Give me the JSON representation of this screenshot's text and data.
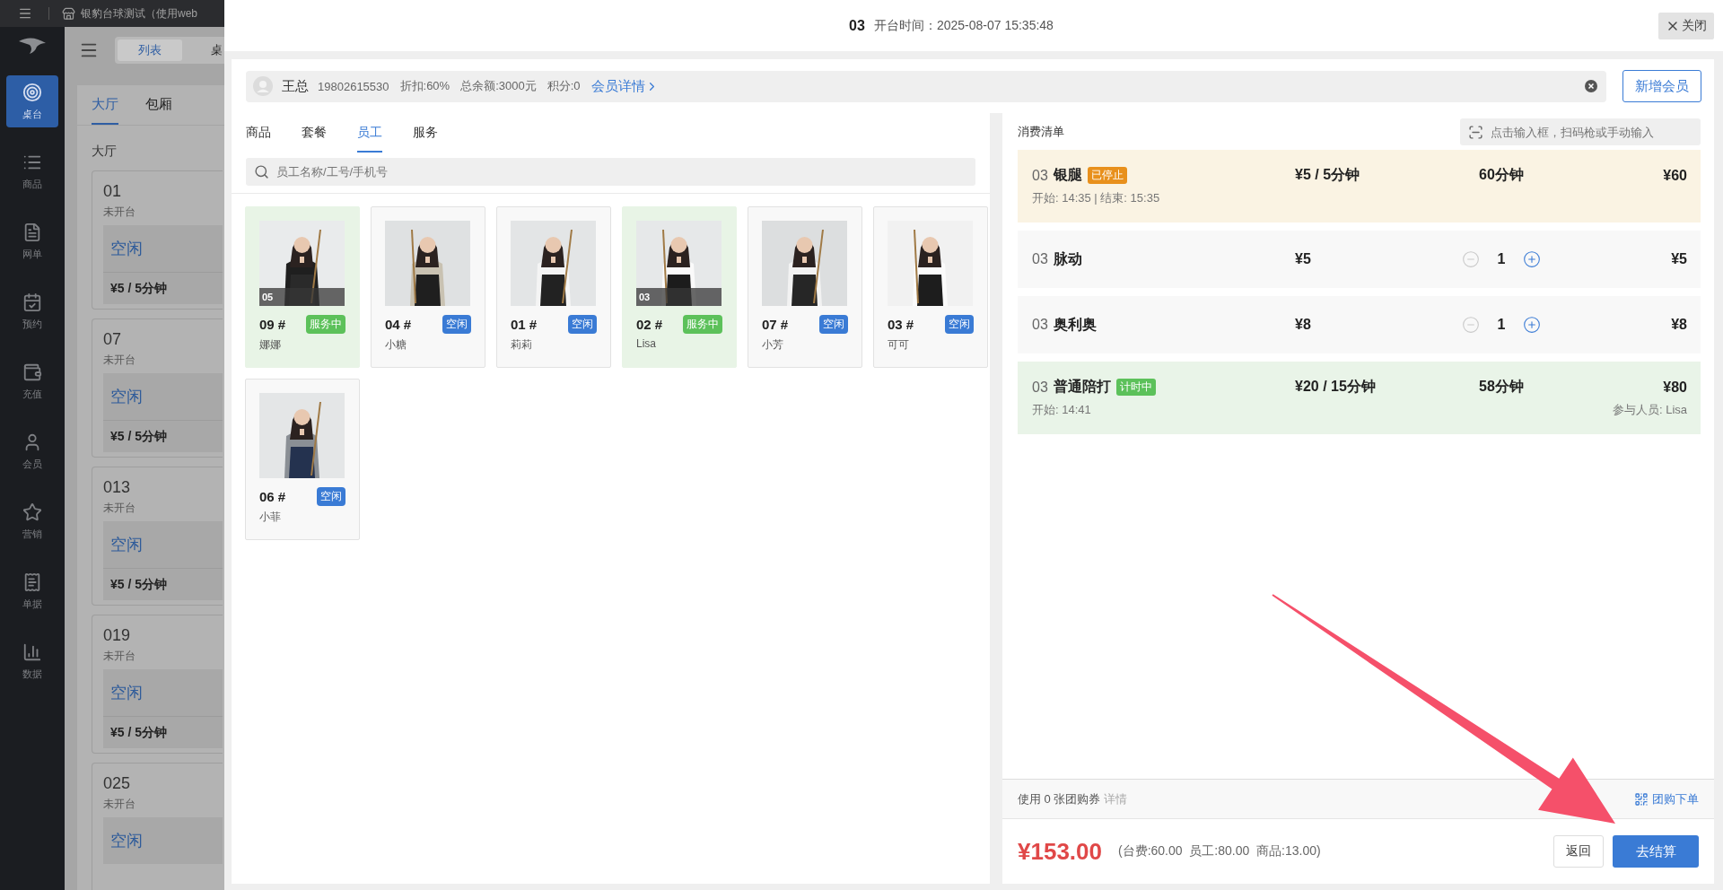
{
  "top_bar": {
    "title": "银豹台球测试（使用web"
  },
  "sidebar": {
    "items": [
      {
        "label": "桌台",
        "selected": true
      },
      {
        "label": "商品",
        "selected": false
      },
      {
        "label": "网单",
        "selected": false
      },
      {
        "label": "预约",
        "selected": false
      },
      {
        "label": "充值",
        "selected": false
      },
      {
        "label": "会员",
        "selected": false
      },
      {
        "label": "营销",
        "selected": false
      },
      {
        "label": "单据",
        "selected": false
      },
      {
        "label": "数据",
        "selected": false
      }
    ]
  },
  "toolbar": {
    "views": [
      {
        "label": "列表",
        "selected": true
      },
      {
        "label": "桌",
        "selected": false
      }
    ]
  },
  "areas": {
    "tabs": [
      {
        "label": "大厅",
        "selected": true
      },
      {
        "label": "包厢",
        "selected": false
      }
    ],
    "section": "大厅",
    "tables": [
      {
        "number": "01",
        "state": "未开台",
        "status": "空闲",
        "price": "¥5 / 5分钟"
      },
      {
        "number": "07",
        "state": "未开台",
        "status": "空闲",
        "price": "¥5 / 5分钟"
      },
      {
        "number": "013",
        "state": "未开台",
        "status": "空闲",
        "price": "¥5 / 5分钟"
      },
      {
        "number": "019",
        "state": "未开台",
        "status": "空闲",
        "price": "¥5 / 5分钟"
      },
      {
        "number": "025",
        "state": "未开台",
        "status": "空闲"
      }
    ]
  },
  "modal": {
    "table": "03",
    "open_time": "开台时间：2025-08-07 15:35:48",
    "close_button": "关闭",
    "member": {
      "name": "王总",
      "phone": "19802615530",
      "discount": "折扣:60%",
      "balance": "总余额:3000元",
      "points": "积分:0",
      "detail_link": "会员详情"
    },
    "add_member_button": "新增会员",
    "tabs": [
      {
        "label": "商品",
        "selected": false
      },
      {
        "label": "套餐",
        "selected": false
      },
      {
        "label": "员工",
        "selected": true
      },
      {
        "label": "服务",
        "selected": false
      }
    ],
    "search": {
      "placeholder": "员工名称/工号/手机号"
    },
    "staff": [
      {
        "number": "09 #",
        "name": "娜娜",
        "status": "服务中",
        "kind": "serving",
        "table_badge": "05"
      },
      {
        "number": "04 #",
        "name": "小糖",
        "status": "空闲",
        "kind": "idle"
      },
      {
        "number": "01 #",
        "name": "莉莉",
        "status": "空闲",
        "kind": "idle"
      },
      {
        "number": "02 #",
        "name": "Lisa",
        "status": "服务中",
        "kind": "serving",
        "table_badge": "03"
      },
      {
        "number": "07 #",
        "name": "小芳",
        "status": "空闲",
        "kind": "idle"
      },
      {
        "number": "03 #",
        "name": "可可",
        "status": "空闲",
        "kind": "idle"
      },
      {
        "number": "06 #",
        "name": "小菲",
        "status": "空闲",
        "kind": "idle"
      }
    ],
    "order": {
      "title": "消费清单",
      "scan": {
        "placeholder": "点击输入框，扫码枪或手动输入"
      },
      "items": [
        {
          "kind": "timed",
          "table": "03",
          "name": "银腿",
          "badge": {
            "text": "已停止",
            "kind": "stopped"
          },
          "price": "¥5 / 5分钟",
          "duration": "60分钟",
          "amount": "¥60",
          "times": "开始: 14:35 | 结束: 15:35"
        },
        {
          "kind": "product",
          "table": "03",
          "name": "脉动",
          "price": "¥5",
          "qty": "1",
          "minus_disabled": true,
          "amount": "¥5"
        },
        {
          "kind": "product",
          "table": "03",
          "name": "奥利奥",
          "price": "¥8",
          "qty": "1",
          "minus_disabled": true,
          "amount": "¥8"
        },
        {
          "kind": "timed",
          "table": "03",
          "name": "普通陪打",
          "badge": {
            "text": "计时中",
            "kind": "running"
          },
          "price": "¥20 / 15分钟",
          "duration": "58分钟",
          "amount": "¥80",
          "times": "开始: 14:41",
          "participants": "参与人员: Lisa"
        }
      ]
    },
    "coupon": {
      "text": "使用 0 张团购券",
      "detail": "详情",
      "group_order": "团购下单"
    },
    "total": {
      "amount": "¥153.00",
      "breakdown": "(台费:60.00  员工:80.00  商品:13.00)",
      "back_button": "返回",
      "checkout_button": "去结算"
    }
  }
}
